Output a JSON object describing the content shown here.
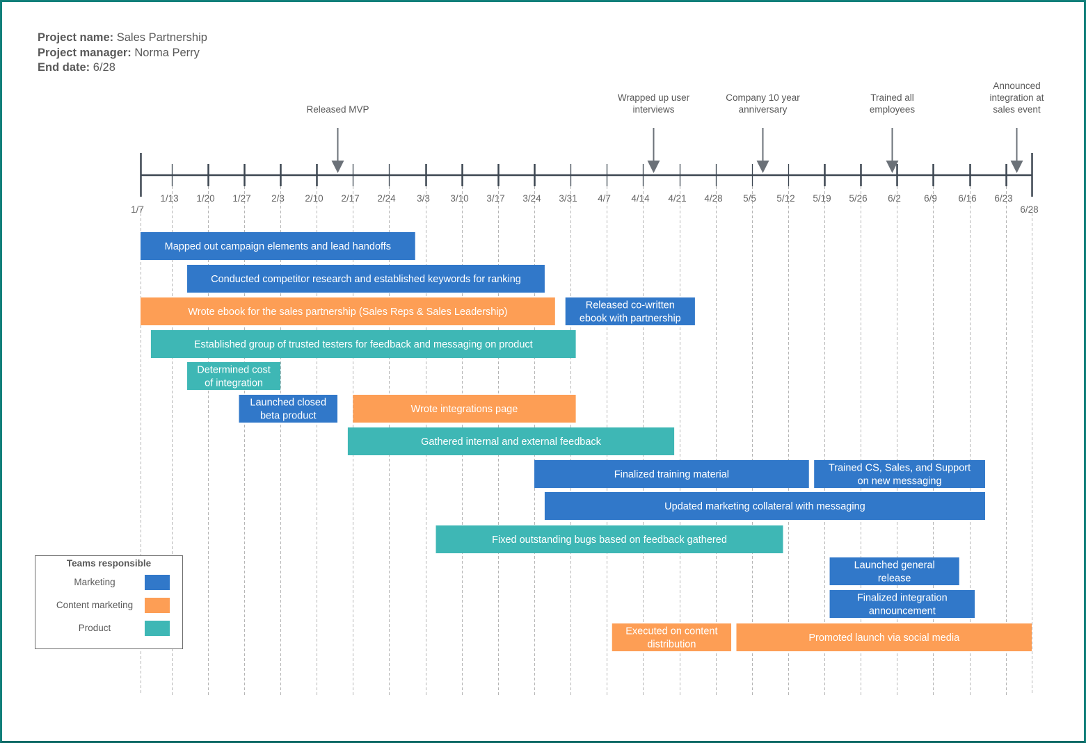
{
  "header": {
    "project_name_label": "Project name:",
    "project_name": "Sales Partnership",
    "project_manager_label": "Project manager:",
    "project_manager": "Norma Perry",
    "end_date_label": "End date:",
    "end_date": "6/28"
  },
  "colors": {
    "marketing": "#3178c9",
    "content_marketing": "#fd9e55",
    "product": "#3eb7b5",
    "axis": "#3c4651",
    "milestone_arrow": "#6b7178",
    "gridline": "#b5b5b5",
    "frame": "#127f7a"
  },
  "legend": {
    "title": "Teams responsible",
    "items": [
      {
        "label": "Marketing",
        "team": "marketing"
      },
      {
        "label": "Content marketing",
        "team": "content_marketing"
      },
      {
        "label": "Product",
        "team": "product"
      }
    ]
  },
  "chart_data": {
    "type": "gantt",
    "title": "",
    "time_unit": "days since 1/7",
    "x_range_days": [
      0,
      172
    ],
    "grid": true,
    "legend_placement": "bottom-left",
    "ticks": [
      {
        "label": "1/7",
        "day": 0,
        "major": true,
        "end": true
      },
      {
        "label": "1/13",
        "day": 6,
        "major": false
      },
      {
        "label": "1/20",
        "day": 13,
        "major": true
      },
      {
        "label": "1/27",
        "day": 20,
        "major": true
      },
      {
        "label": "2/3",
        "day": 27,
        "major": true
      },
      {
        "label": "2/10",
        "day": 34,
        "major": true
      },
      {
        "label": "2/17",
        "day": 41,
        "major": false
      },
      {
        "label": "2/24",
        "day": 48,
        "major": false
      },
      {
        "label": "3/3",
        "day": 55,
        "major": true
      },
      {
        "label": "3/10",
        "day": 62,
        "major": true
      },
      {
        "label": "3/17",
        "day": 69,
        "major": true
      },
      {
        "label": "3/24",
        "day": 76,
        "major": true
      },
      {
        "label": "3/31",
        "day": 83,
        "major": false
      },
      {
        "label": "4/7",
        "day": 90,
        "major": false
      },
      {
        "label": "4/14",
        "day": 97,
        "major": false
      },
      {
        "label": "4/21",
        "day": 104,
        "major": false
      },
      {
        "label": "4/28",
        "day": 111,
        "major": false
      },
      {
        "label": "5/5",
        "day": 118,
        "major": false
      },
      {
        "label": "5/12",
        "day": 125,
        "major": false
      },
      {
        "label": "5/19",
        "day": 132,
        "major": true
      },
      {
        "label": "5/26",
        "day": 139,
        "major": true
      },
      {
        "label": "6/2",
        "day": 146,
        "major": true
      },
      {
        "label": "6/9",
        "day": 153,
        "major": true
      },
      {
        "label": "6/16",
        "day": 160,
        "major": true
      },
      {
        "label": "6/23",
        "day": 167,
        "major": true
      },
      {
        "label": "6/28",
        "day": 172,
        "major": true,
        "end": true
      }
    ],
    "milestones": [
      {
        "label": [
          "Released MVP"
        ],
        "day": 38
      },
      {
        "label": [
          "Wrapped up user",
          "interviews"
        ],
        "day": 99
      },
      {
        "label": [
          "Company 10 year",
          "anniversary"
        ],
        "day": 120
      },
      {
        "label": [
          "Trained all",
          "employees"
        ],
        "day": 145
      },
      {
        "label": [
          "Announced",
          "integration at",
          "sales event"
        ],
        "day": 169
      }
    ],
    "tasks": [
      {
        "label": [
          "Mapped out campaign elements and lead handoffs"
        ],
        "team": "marketing",
        "start": 0,
        "end": 53,
        "row": 0
      },
      {
        "label": [
          "Conducted competitor research and established keywords for ranking"
        ],
        "team": "marketing",
        "start": 9,
        "end": 78,
        "row": 1
      },
      {
        "label": [
          "Wrote ebook for the sales partnership (Sales Reps & Sales Leadership)"
        ],
        "team": "content_marketing",
        "start": 0,
        "end": 80,
        "row": 2
      },
      {
        "label": [
          "Released co-written",
          "ebook with partnership"
        ],
        "team": "marketing",
        "start": 82,
        "end": 107,
        "row": 2
      },
      {
        "label": [
          "Established group of trusted testers for feedback and messaging on product"
        ],
        "team": "product",
        "start": 2,
        "end": 84,
        "row": 3
      },
      {
        "label": [
          "Determined cost",
          "of integration"
        ],
        "team": "product",
        "start": 9,
        "end": 27,
        "row": 4
      },
      {
        "label": [
          "Launched closed",
          "beta product"
        ],
        "team": "marketing",
        "start": 19,
        "end": 38,
        "row": 5
      },
      {
        "label": [
          "Wrote integrations page"
        ],
        "team": "content_marketing",
        "start": 41,
        "end": 84,
        "row": 5
      },
      {
        "label": [
          "Gathered internal and external feedback"
        ],
        "team": "product",
        "start": 40,
        "end": 103,
        "row": 6
      },
      {
        "label": [
          "Finalized training material"
        ],
        "team": "marketing",
        "start": 76,
        "end": 129,
        "row": 7
      },
      {
        "label": [
          "Trained CS, Sales, and Support",
          "on new messaging"
        ],
        "team": "marketing",
        "start": 130,
        "end": 163,
        "row": 7
      },
      {
        "label": [
          "Updated marketing collateral with messaging"
        ],
        "team": "marketing",
        "start": 78,
        "end": 163,
        "row": 8
      },
      {
        "label": [
          "Fixed outstanding bugs based on feedback gathered"
        ],
        "team": "product",
        "start": 57,
        "end": 124,
        "row": 9
      },
      {
        "label": [
          "Launched general",
          "release"
        ],
        "team": "marketing",
        "start": 133,
        "end": 158,
        "row": 10
      },
      {
        "label": [
          "Finalized integration",
          "announcement"
        ],
        "team": "marketing",
        "start": 133,
        "end": 161,
        "row": 11
      },
      {
        "label": [
          "Executed on content",
          "distribution"
        ],
        "team": "content_marketing",
        "start": 91,
        "end": 114,
        "row": 12
      },
      {
        "label": [
          "Promoted launch via social media"
        ],
        "team": "content_marketing",
        "start": 115,
        "end": 172,
        "row": 12
      }
    ]
  }
}
